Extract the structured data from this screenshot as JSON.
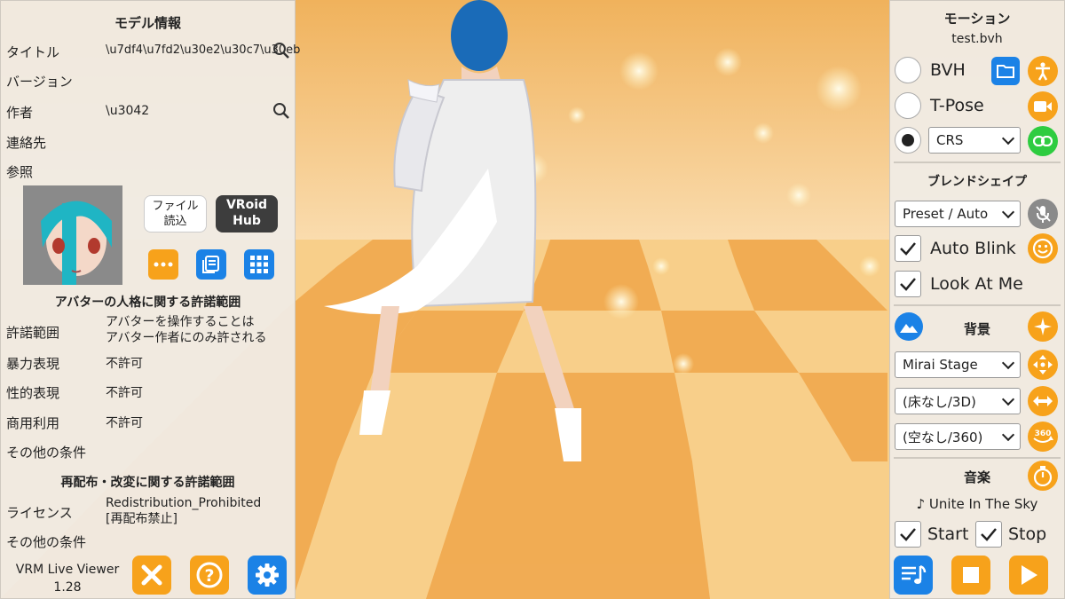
{
  "left_panel": {
    "title": "モデル情報",
    "fields": {
      "title_label": "タイトル",
      "title_value": "\\u7df4\\u7fd2\\u30e2\\u30c7\\u30eb",
      "version_label": "バージョン",
      "author_label": "作者",
      "author_value": "\\u3042",
      "contact_label": "連絡先",
      "reference_label": "参照"
    },
    "buttons": {
      "file_load": "ファイル\n読込",
      "vroid_hub": "VRoid\nHub"
    },
    "personality_section": {
      "title": "アバターの人格に関する許諾範囲",
      "rows": [
        {
          "label": "許諾範囲",
          "value": "アバターを操作することは\nアバター作者にのみ許される"
        },
        {
          "label": "暴力表現",
          "value": "不許可"
        },
        {
          "label": "性的表現",
          "value": "不許可"
        },
        {
          "label": "商用利用",
          "value": "不許可"
        },
        {
          "label": "その他の条件",
          "value": ""
        }
      ]
    },
    "redistribution_section": {
      "title": "再配布・改変に関する許諾範囲",
      "license_label": "ライセンス",
      "license_value": "Redistribution_Prohibited\n[再配布禁止]",
      "other_label": "その他の条件"
    },
    "app_name": "VRM Live Viewer",
    "app_version": "1.28"
  },
  "right_panel": {
    "motion_title": "モーション",
    "motion_file": "test.bvh",
    "motion_options": {
      "bvh": "BVH",
      "tpose": "T-Pose"
    },
    "motion_select": "CRS",
    "blend_title": "ブレンドシェイプ",
    "blend_select": "Preset / Auto",
    "auto_blink": "Auto Blink",
    "look_at_me": "Look At Me",
    "bg_title": "背景",
    "stage_select": "Mirai Stage",
    "floor_select": "(床なし/3D)",
    "sky_select": "(空なし/360)",
    "music_title": "音楽",
    "track": "♪ Unite In The Sky",
    "start_label": "Start",
    "stop_label": "Stop"
  },
  "colors": {
    "accent_blue": "#1b82e6",
    "accent_orange": "#f7a21b",
    "accent_green": "#2ecc40",
    "stage_orange": "#f3b25c"
  },
  "icons": [
    "search-icon",
    "more-icon",
    "document-icon",
    "grid-icon",
    "close-icon",
    "help-icon",
    "gear-icon",
    "folder-icon",
    "person-icon",
    "video-icon",
    "link-icon",
    "mic-off-icon",
    "smiley-icon",
    "mountain-icon",
    "sparkle-icon",
    "move-icon",
    "horizontal-arrows-icon",
    "rotate-360-icon",
    "timer-icon",
    "playlist-icon",
    "stop-icon",
    "play-icon"
  ]
}
